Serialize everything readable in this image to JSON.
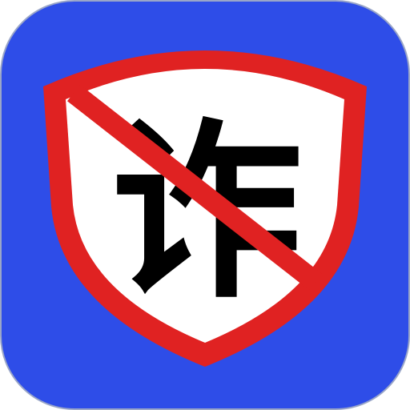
{
  "icon": {
    "character": "诈",
    "colors": {
      "background": "#2e4de8",
      "border": "#9aa6c8",
      "shield_fill": "#ffffff",
      "shield_outline": "#e02222",
      "prohibition_slash": "#e02222",
      "character": "#000000"
    },
    "icon_names": [
      "shield-icon",
      "prohibition-slash-icon"
    ]
  }
}
